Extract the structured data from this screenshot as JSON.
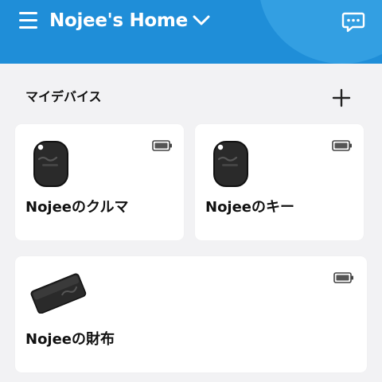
{
  "header": {
    "title": "Nojee's Home",
    "bg_color": "#1f8ed8",
    "icons": [
      "menu-icon",
      "chevron-down-icon",
      "chat-icon"
    ]
  },
  "section": {
    "title": "マイデバイス",
    "add_icon": "plus-icon"
  },
  "devices": [
    {
      "name": "Nojeeのクルマ",
      "type": "tag",
      "battery_icon": "battery-full-icon"
    },
    {
      "name": "Nojeeのキー",
      "type": "tag",
      "battery_icon": "battery-full-icon"
    },
    {
      "name": "Nojeeの財布",
      "type": "card",
      "battery_icon": "battery-full-icon"
    }
  ]
}
